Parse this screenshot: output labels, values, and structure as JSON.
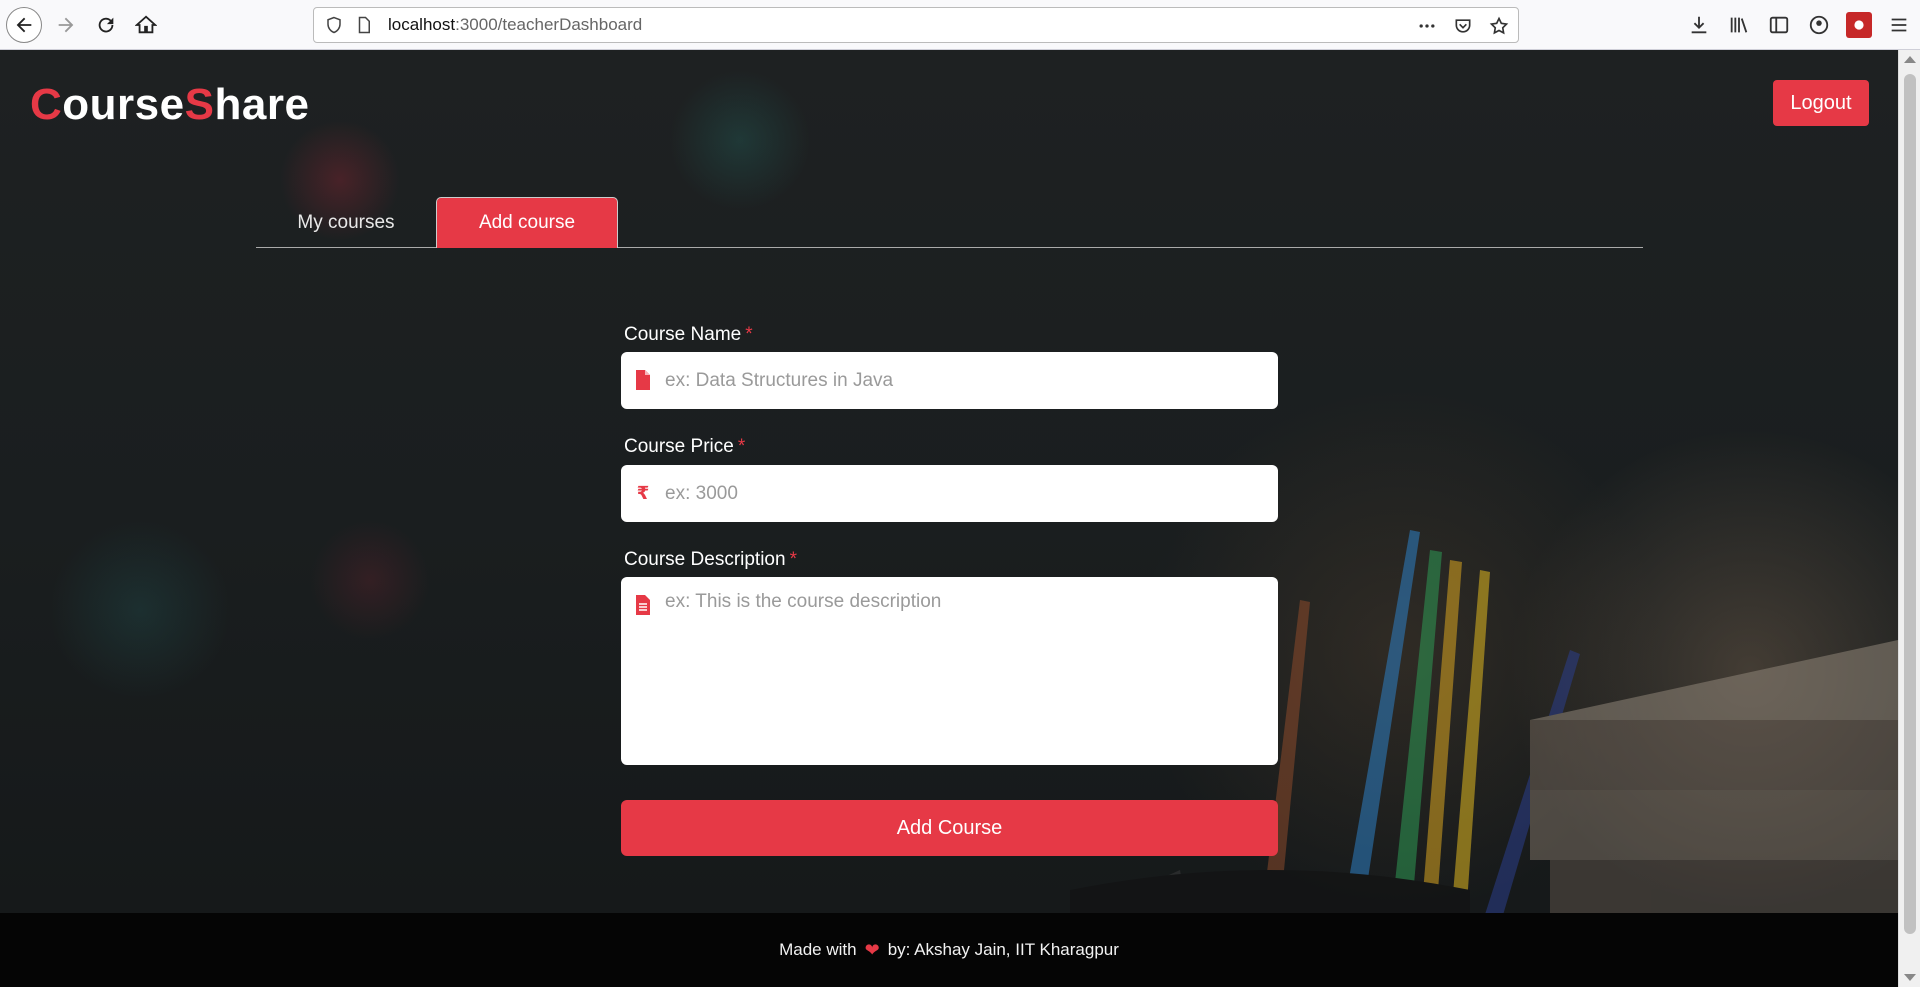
{
  "browser": {
    "url_host": "localhost",
    "url_path": ":3000/teacherDashboard"
  },
  "brand": {
    "logo_part1_accent": "C",
    "logo_part1": "ourse",
    "logo_part2_accent": "S",
    "logo_part2": "hare",
    "accent_color": "#e63946"
  },
  "header": {
    "logout_label": "Logout"
  },
  "tabs": [
    {
      "label": "My courses",
      "active": false
    },
    {
      "label": "Add course",
      "active": true
    }
  ],
  "form": {
    "course_name": {
      "label": "Course Name",
      "required_mark": "*",
      "placeholder": "ex: Data Structures in Java",
      "icon": "file-icon"
    },
    "course_price": {
      "label": "Course Price",
      "required_mark": "*",
      "placeholder": "ex: 3000",
      "icon": "rupee-icon",
      "icon_glyph": "₹"
    },
    "course_description": {
      "label": "Course Description",
      "required_mark": "*",
      "placeholder": "ex: This is the course description",
      "icon": "file-text-icon"
    },
    "submit_label": "Add Course"
  },
  "footer": {
    "prefix": "Made with",
    "heart": "❤",
    "suffix": "by: Akshay Jain, IIT Kharagpur"
  }
}
